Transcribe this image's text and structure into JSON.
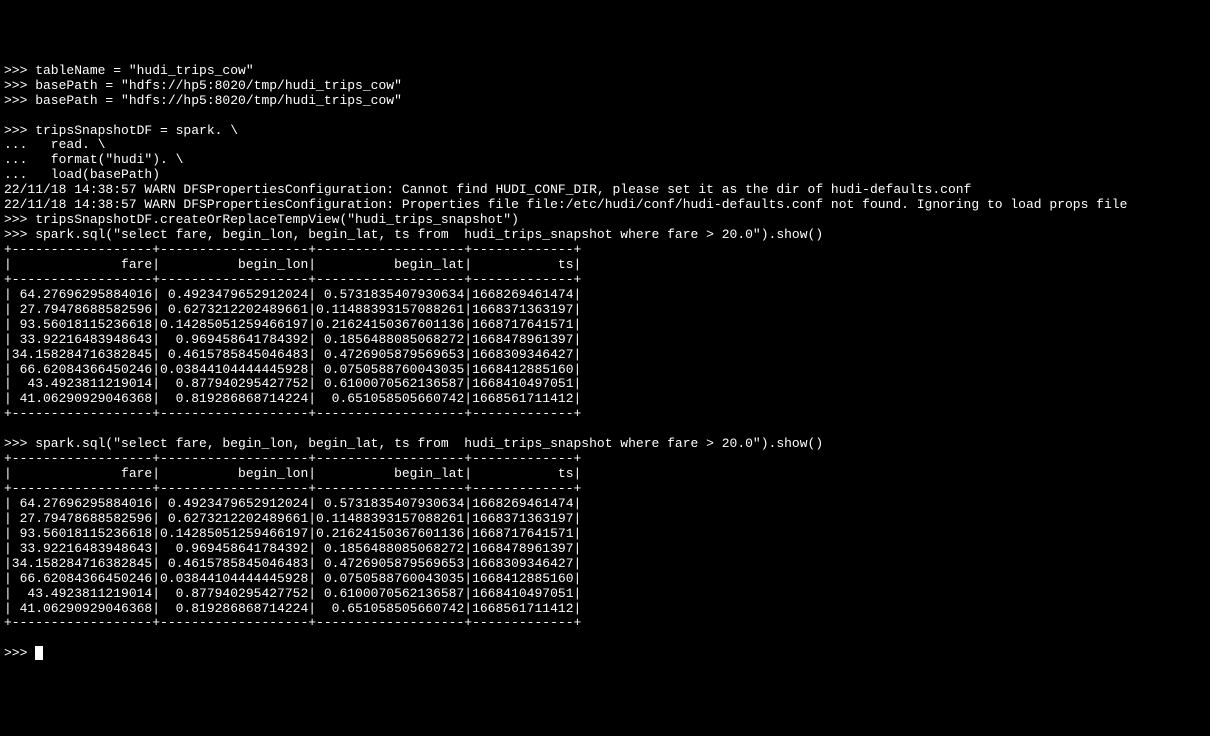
{
  "lines": {
    "l1": ">>> tableName = \"hudi_trips_cow\"",
    "l2": ">>> basePath = \"hdfs://hp5:8020/tmp/hudi_trips_cow\"",
    "l3": ">>> basePath = \"hdfs://hp5:8020/tmp/hudi_trips_cow\"",
    "l4": "",
    "l5": ">>> tripsSnapshotDF = spark. \\",
    "l6": "...   read. \\",
    "l7": "...   format(\"hudi\"). \\",
    "l8": "...   load(basePath)",
    "l9": "22/11/18 14:38:57 WARN DFSPropertiesConfiguration: Cannot find HUDI_CONF_DIR, please set it as the dir of hudi-defaults.conf",
    "l10": "22/11/18 14:38:57 WARN DFSPropertiesConfiguration: Properties file file:/etc/hudi/conf/hudi-defaults.conf not found. Ignoring to load props file",
    "l11": ">>> tripsSnapshotDF.createOrReplaceTempView(\"hudi_trips_snapshot\")",
    "l12": ">>> spark.sql(\"select fare, begin_lon, begin_lat, ts from  hudi_trips_snapshot where fare > 20.0\").show()",
    "l13": "+------------------+-------------------+-------------------+-------------+",
    "l14": "|              fare|          begin_lon|          begin_lat|           ts|",
    "l15": "+------------------+-------------------+-------------------+-------------+",
    "l16": "| 64.27696295884016| 0.4923479652912024| 0.5731835407930634|1668269461474|",
    "l17": "| 27.79478688582596| 0.6273212202489661|0.11488393157088261|1668371363197|",
    "l18": "| 93.56018115236618|0.14285051259466197|0.21624150367601136|1668717641571|",
    "l19": "| 33.92216483948643|  0.969458641784392| 0.1856488085068272|1668478961397|",
    "l20": "|34.158284716382845| 0.4615785845046483| 0.4726905879569653|1668309346427|",
    "l21": "| 66.62084366450246|0.03844104444445928| 0.0750588760043035|1668412885160|",
    "l22": "|  43.4923811219014|  0.877940295427752| 0.6100070562136587|1668410497051|",
    "l23": "| 41.06290929046368|  0.819286868714224|  0.651058505660742|1668561711412|",
    "l24": "+------------------+-------------------+-------------------+-------------+",
    "l25": "",
    "l26": ">>> spark.sql(\"select fare, begin_lon, begin_lat, ts from  hudi_trips_snapshot where fare > 20.0\").show()",
    "l27": "+------------------+-------------------+-------------------+-------------+",
    "l28": "|              fare|          begin_lon|          begin_lat|           ts|",
    "l29": "+------------------+-------------------+-------------------+-------------+",
    "l30": "| 64.27696295884016| 0.4923479652912024| 0.5731835407930634|1668269461474|",
    "l31": "| 27.79478688582596| 0.6273212202489661|0.11488393157088261|1668371363197|",
    "l32": "| 93.56018115236618|0.14285051259466197|0.21624150367601136|1668717641571|",
    "l33": "| 33.92216483948643|  0.969458641784392| 0.1856488085068272|1668478961397|",
    "l34": "|34.158284716382845| 0.4615785845046483| 0.4726905879569653|1668309346427|",
    "l35": "| 66.62084366450246|0.03844104444445928| 0.0750588760043035|1668412885160|",
    "l36": "|  43.4923811219014|  0.877940295427752| 0.6100070562136587|1668410497051|",
    "l37": "| 41.06290929046368|  0.819286868714224|  0.651058505660742|1668561711412|",
    "l38": "+------------------+-------------------+-------------------+-------------+",
    "l39": "",
    "l40": ">>> "
  },
  "chart_data": {
    "type": "table",
    "title": "hudi_trips_snapshot where fare > 20.0",
    "columns": [
      "fare",
      "begin_lon",
      "begin_lat",
      "ts"
    ],
    "rows": [
      [
        64.27696295884016,
        0.4923479652912024,
        0.5731835407930634,
        1668269461474
      ],
      [
        27.79478688582596,
        0.6273212202489661,
        0.11488393157088261,
        1668371363197
      ],
      [
        93.56018115236618,
        0.14285051259466197,
        0.21624150367601136,
        1668717641571
      ],
      [
        33.92216483948643,
        0.969458641784392,
        0.1856488085068272,
        1668478961397
      ],
      [
        34.158284716382845,
        0.4615785845046483,
        0.4726905879569653,
        1668309346427
      ],
      [
        66.62084366450246,
        0.03844104444445928,
        0.0750588760043035,
        1668412885160
      ],
      [
        43.4923811219014,
        0.877940295427752,
        0.6100070562136587,
        1668410497051
      ],
      [
        41.06290929046368,
        0.819286868714224,
        0.651058505660742,
        1668561711412
      ]
    ]
  }
}
